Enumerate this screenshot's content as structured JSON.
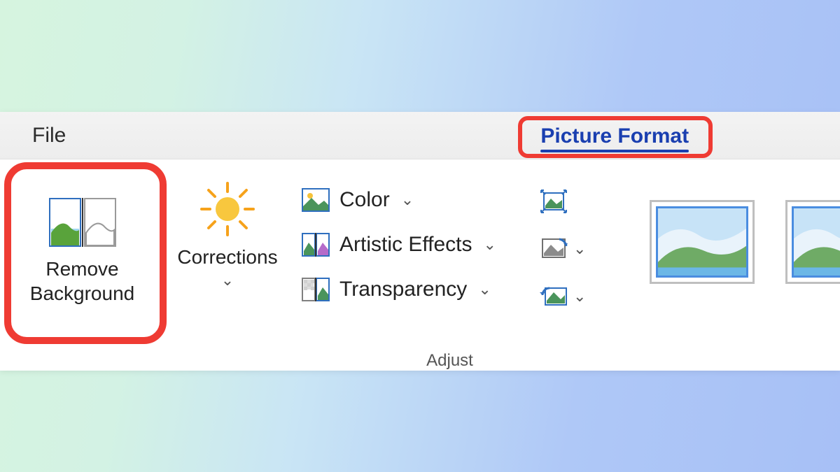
{
  "tabs": {
    "file": "File",
    "picture_format": "Picture Format"
  },
  "ribbon": {
    "remove_background": "Remove\nBackground",
    "corrections": "Corrections",
    "color": "Color",
    "artistic_effects": "Artistic Effects",
    "transparency": "Transparency",
    "adjust_group_label": "Adjust"
  },
  "icons": {
    "remove_background": "remove-background-icon",
    "corrections_sun": "sun-icon",
    "color": "picture-color-icon",
    "artistic": "artistic-effects-icon",
    "transparency": "transparency-icon",
    "compress": "compress-pictures-icon",
    "change": "change-picture-icon",
    "reset": "reset-picture-icon",
    "caret": "chevron-down-icon"
  },
  "highlights": {
    "picture_format_tab": true,
    "remove_background_button": true
  },
  "colors": {
    "highlight": "#ef3b33",
    "accent": "#1a3fb0"
  }
}
